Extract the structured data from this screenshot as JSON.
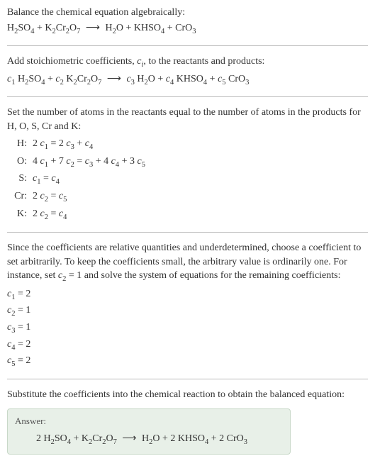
{
  "section1": {
    "line1": "Balance the chemical equation algebraically:",
    "eq_lhs1": "H",
    "eq_lhs2": "SO",
    "eq_lhs3": " + K",
    "eq_lhs4": "Cr",
    "eq_lhs5": "O",
    "arrow": "⟶",
    "eq_rhs1": "H",
    "eq_rhs2": "O + KHSO",
    "eq_rhs3": " + CrO"
  },
  "section2": {
    "line1_a": "Add stoichiometric coefficients, ",
    "line1_b": "c",
    "line1_c": ", to the reactants and products:",
    "c1": "c",
    "c2": "c",
    "c3": "c",
    "c4": "c",
    "c5": "c",
    "h2so4_a": " H",
    "h2so4_b": "SO",
    "plus": " + ",
    "k2cr2o7_a": " K",
    "k2cr2o7_b": "Cr",
    "k2cr2o7_c": "O",
    "arrow": "⟶",
    "h2o_a": " H",
    "h2o_b": "O + ",
    "khso4_a": " KHSO",
    "khso4_b": " + ",
    "cro3_a": " CrO"
  },
  "section3": {
    "line1": "Set the number of atoms in the reactants equal to the number of atoms in the products for H, O, S, Cr and K:",
    "atoms": [
      {
        "label": "H:",
        "eq_parts": [
          "2 ",
          "c",
          "1",
          " = 2 ",
          "c",
          "3",
          " + ",
          "c",
          "4"
        ]
      },
      {
        "label": "O:",
        "eq_parts": [
          "4 ",
          "c",
          "1",
          " + 7 ",
          "c",
          "2",
          " = ",
          "c",
          "3",
          " + 4 ",
          "c",
          "4",
          " + 3 ",
          "c",
          "5"
        ]
      },
      {
        "label": "S:",
        "eq_parts": [
          "c",
          "1",
          " = ",
          "c",
          "4"
        ]
      },
      {
        "label": "Cr:",
        "eq_parts": [
          "2 ",
          "c",
          "2",
          " = ",
          "c",
          "5"
        ]
      },
      {
        "label": "K:",
        "eq_parts": [
          "2 ",
          "c",
          "2",
          " = ",
          "c",
          "4"
        ]
      }
    ]
  },
  "section4": {
    "para_a": "Since the coefficients are relative quantities and underdetermined, choose a coefficient to set arbitrarily. To keep the coefficients small, the arbitrary value is ordinarily one. For instance, set ",
    "para_b": "c",
    "para_c": " = 1 and solve the system of equations for the remaining coefficients:",
    "coefs": [
      {
        "var": "c",
        "sub": "1",
        "val": " = 2"
      },
      {
        "var": "c",
        "sub": "2",
        "val": " = 1"
      },
      {
        "var": "c",
        "sub": "3",
        "val": " = 1"
      },
      {
        "var": "c",
        "sub": "4",
        "val": " = 2"
      },
      {
        "var": "c",
        "sub": "5",
        "val": " = 2"
      }
    ]
  },
  "section5": {
    "line1": "Substitute the coefficients into the chemical reaction to obtain the balanced equation:",
    "answer_label": "Answer:",
    "answer_pre": "2 H",
    "answer_a": "SO",
    "answer_b": " + K",
    "answer_c": "Cr",
    "answer_d": "O",
    "arrow": "⟶",
    "answer_e": "H",
    "answer_f": "O + 2 KHSO",
    "answer_g": " + 2 CrO"
  },
  "subs": {
    "2": "2",
    "4": "4",
    "7": "7",
    "3": "3",
    "i": "i",
    "1": "1",
    "5": "5"
  }
}
